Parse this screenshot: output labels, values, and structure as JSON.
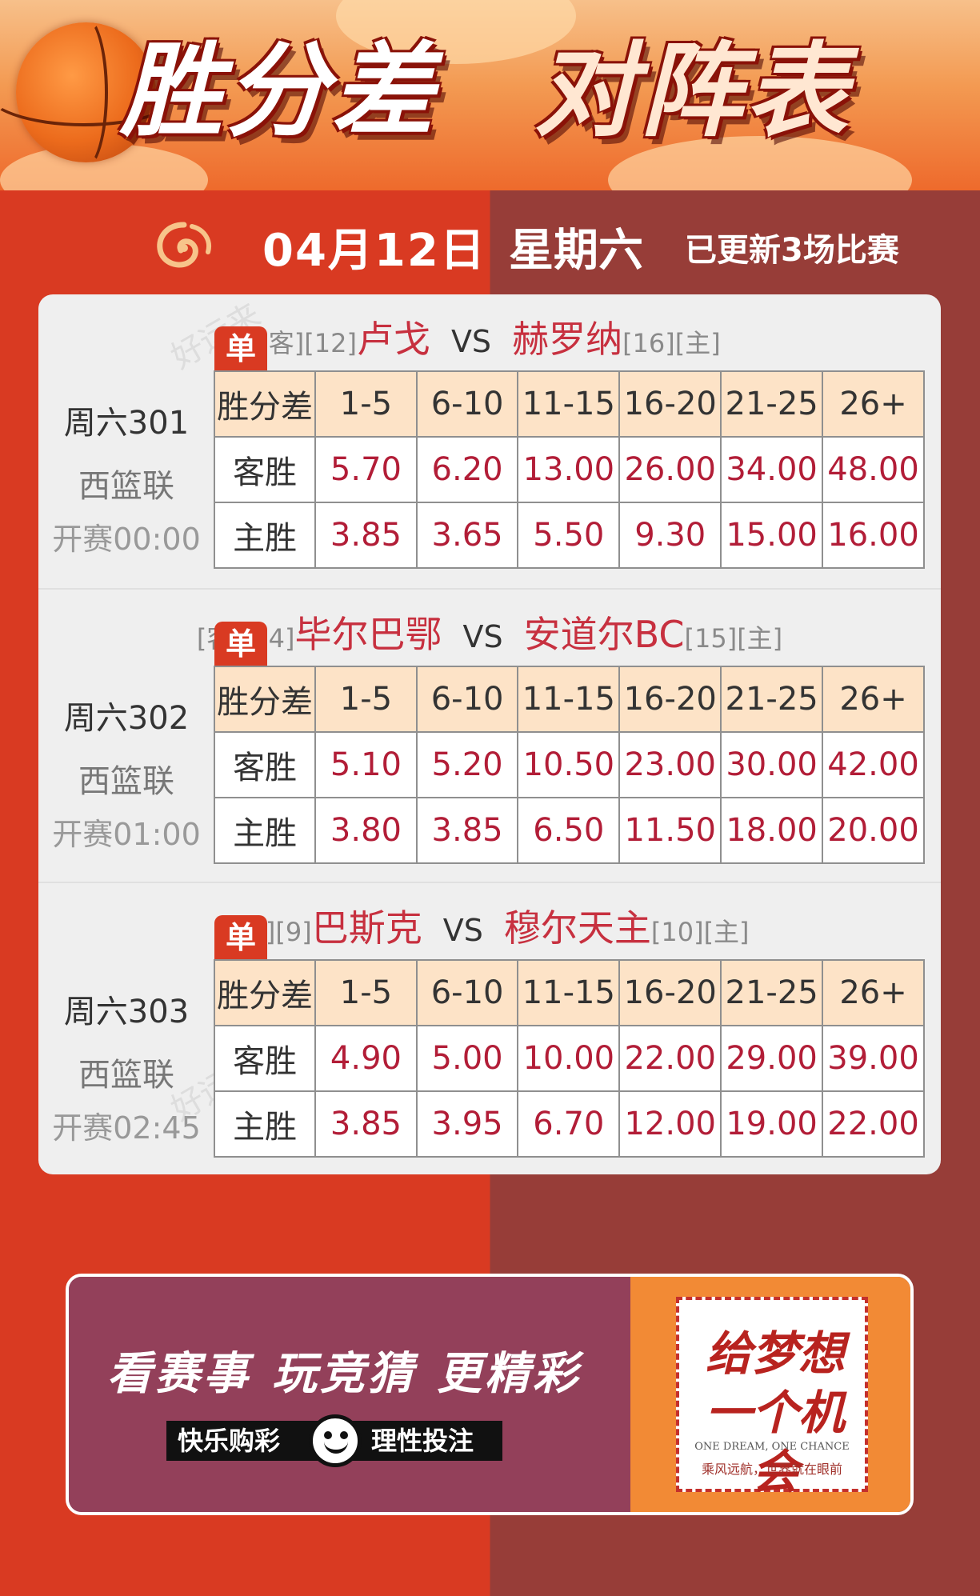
{
  "banner": {
    "title_left": "胜分差",
    "title_right": "对阵表"
  },
  "date_row": {
    "date": "04月12日",
    "weekday": "星期六",
    "update": "已更新3场比赛"
  },
  "table_headers": [
    "胜分差",
    "1-5",
    "6-10",
    "11-15",
    "16-20",
    "21-25",
    "26+"
  ],
  "row_labels": {
    "away": "客胜",
    "home": "主胜"
  },
  "single_tag": "单",
  "vs_text": "VS",
  "matches": [
    {
      "code": "周六301",
      "league": "西篮联",
      "time": "开赛00:00",
      "away_tag": "[客][12]",
      "away": "卢戈",
      "home": "赫罗纳",
      "home_tag": "[16][主]",
      "away_odds": [
        "5.70",
        "6.20",
        "13.00",
        "26.00",
        "34.00",
        "48.00"
      ],
      "home_odds": [
        "3.85",
        "3.65",
        "5.50",
        "9.30",
        "15.00",
        "16.00"
      ]
    },
    {
      "code": "周六302",
      "league": "西篮联",
      "time": "开赛01:00",
      "away_tag": "[客][14]",
      "away": "毕尔巴鄂",
      "home": "安道尔BC",
      "home_tag": "[15][主]",
      "away_odds": [
        "5.10",
        "5.20",
        "10.50",
        "23.00",
        "30.00",
        "42.00"
      ],
      "home_odds": [
        "3.80",
        "3.85",
        "6.50",
        "11.50",
        "18.00",
        "20.00"
      ]
    },
    {
      "code": "周六303",
      "league": "西篮联",
      "time": "开赛02:45",
      "away_tag": "[客][9]",
      "away": "巴斯克",
      "home": "穆尔天主",
      "home_tag": "[10][主]",
      "away_odds": [
        "4.90",
        "5.00",
        "10.00",
        "22.00",
        "29.00",
        "39.00"
      ],
      "home_odds": [
        "3.85",
        "3.95",
        "6.70",
        "12.00",
        "19.00",
        "22.00"
      ]
    }
  ],
  "ad": {
    "slogan": [
      "看赛事",
      "玩竞猜",
      "更精彩"
    ],
    "badge_left": "快乐购彩",
    "badge_right": "理性投注",
    "stamp_main": "给梦想一个机会",
    "stamp_en": "ONE DREAM, ONE CHANCE",
    "stamp_cn": "乘风远航，世界就在眼前"
  },
  "watermark": "好运来",
  "colors": {
    "red": "#d93a22",
    "maroon": "#973d38",
    "odds": "#b21d37",
    "team": "#c7303f",
    "header_bg": "#fde3c7"
  }
}
